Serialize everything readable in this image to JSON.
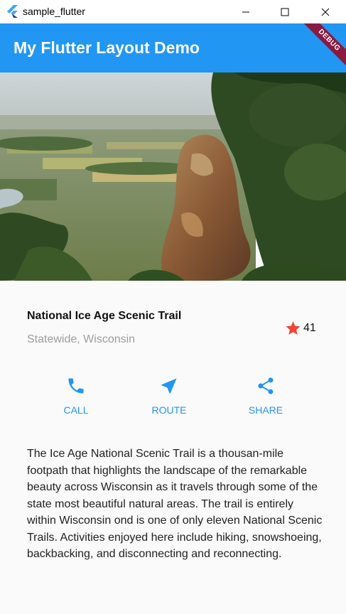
{
  "window": {
    "title": "sample_flutter"
  },
  "appbar": {
    "title": "My Flutter Layout Demo",
    "debug_banner": "DEBUG"
  },
  "place": {
    "name": "National Ice Age Scenic Trail",
    "location": "Statewide, Wisconsin",
    "favorite_count": "41"
  },
  "actions": {
    "call": "CALL",
    "route": "ROUTE",
    "share": "SHARE"
  },
  "description": "The Ice Age National Scenic Trail is a thousan-mile footpath that highlights the landscape of the remarkable beauty across Wisconsin as it travels through some of the state most beautiful natural areas. The trail is entirely within Wisconsin ond is one of only eleven National Scenic Trails. Activities enjoyed here include hiking, snowshoeing, backbacking, and disconnecting and reconnecting.",
  "colors": {
    "primary": "#2196f3",
    "star": "#f44336",
    "subtitle": "#9e9e9e",
    "debug_banner": "#8a1a3f"
  },
  "icons": {
    "app": "flutter-logo-icon",
    "minimize": "minimize-icon",
    "maximize": "maximize-icon",
    "close": "close-icon",
    "favorite": "star-icon",
    "call": "phone-icon",
    "route": "navigation-icon",
    "share": "share-icon"
  }
}
